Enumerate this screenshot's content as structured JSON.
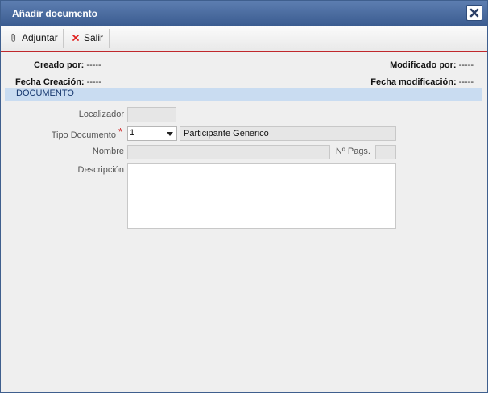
{
  "dialog": {
    "title": "Añadir documento",
    "close_icon": "close-icon"
  },
  "toolbar": {
    "attach_label": "Adjuntar",
    "attach_icon": "paperclip-icon",
    "exit_label": "Salir",
    "exit_icon": "red-x-icon"
  },
  "meta": {
    "created_by_label": "Creado por:",
    "created_by_value": "-----",
    "modified_by_label": "Modificado por:",
    "modified_by_value": "-----",
    "creation_date_label": "Fecha Creación:",
    "creation_date_value": "-----",
    "modification_date_label": "Fecha modificación:",
    "modification_date_value": "-----"
  },
  "section": {
    "title": "DOCUMENTO"
  },
  "form": {
    "locator_label": "Localizador",
    "locator_value": "",
    "doc_type_label": "Tipo Documento",
    "doc_type_required": "*",
    "doc_type_value": "1",
    "doc_type_description": "Participante Generico",
    "name_label": "Nombre",
    "name_value": "",
    "pages_label": "Nº Pags.",
    "pages_value": "",
    "description_label": "Descripción",
    "description_value": ""
  },
  "colors": {
    "titlebar": "#4a6ca0",
    "toolbar_accent": "#c0282c",
    "section_bg": "#c9dcf1",
    "section_text": "#16376e",
    "required": "#d21f1f"
  }
}
